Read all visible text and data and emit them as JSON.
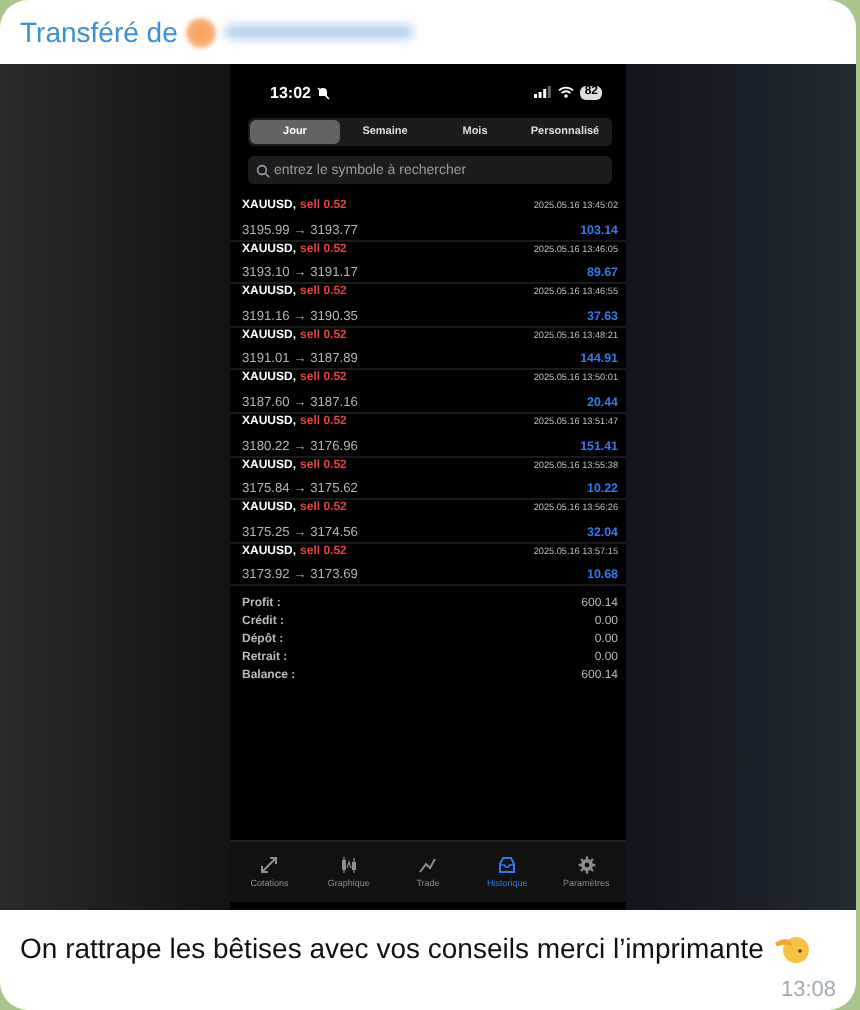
{
  "message": {
    "forwarded_label": "Transféré de",
    "text": "On rattrape les bêtises avec vos conseils merci l’imprimante",
    "time": "13:08"
  },
  "phone": {
    "status_time": "13:02",
    "battery": "82",
    "periods": [
      {
        "label": "Jour",
        "selected": true
      },
      {
        "label": "Semaine",
        "selected": false
      },
      {
        "label": "Mois",
        "selected": false
      },
      {
        "label": "Personnalisé",
        "selected": false
      }
    ],
    "search": {
      "placeholder": "entrez le symbole à rechercher"
    },
    "deals": [
      {
        "symbol": "XAUUSD,",
        "side": "sell 0.52",
        "prices": "3195.99 → 3193.77",
        "time": "2025.05.16 13:45:02",
        "profit": "103.14"
      },
      {
        "symbol": "XAUUSD,",
        "side": "sell 0.52",
        "prices": "3193.10 → 3191.17",
        "time": "2025.05.16 13:46:05",
        "profit": "89.67"
      },
      {
        "symbol": "XAUUSD,",
        "side": "sell 0.52",
        "prices": "3191.16 → 3190.35",
        "time": "2025.05.16 13:46:55",
        "profit": "37.63"
      },
      {
        "symbol": "XAUUSD,",
        "side": "sell 0.52",
        "prices": "3191.01 → 3187.89",
        "time": "2025.05.16 13:48:21",
        "profit": "144.91"
      },
      {
        "symbol": "XAUUSD,",
        "side": "sell 0.52",
        "prices": "3187.60 → 3187.16",
        "time": "2025.05.16 13:50:01",
        "profit": "20.44"
      },
      {
        "symbol": "XAUUSD,",
        "side": "sell 0.52",
        "prices": "3180.22 → 3176.96",
        "time": "2025.05.16 13:51:47",
        "profit": "151.41"
      },
      {
        "symbol": "XAUUSD,",
        "side": "sell 0.52",
        "prices": "3175.84 → 3175.62",
        "time": "2025.05.16 13:55:38",
        "profit": "10.22"
      },
      {
        "symbol": "XAUUSD,",
        "side": "sell 0.52",
        "prices": "3175.25 → 3174.56",
        "time": "2025.05.16 13:56:26",
        "profit": "32.04"
      },
      {
        "symbol": "XAUUSD,",
        "side": "sell 0.52",
        "prices": "3173.92 → 3173.69",
        "time": "2025.05.16 13:57:15",
        "profit": "10.68"
      }
    ],
    "summary": [
      {
        "label": "Profit :",
        "value": "600.14"
      },
      {
        "label": "Crédit :",
        "value": "0.00"
      },
      {
        "label": "Dépôt :",
        "value": "0.00"
      },
      {
        "label": "Retrait :",
        "value": "0.00"
      },
      {
        "label": "Balance :",
        "value": "600.14"
      }
    ],
    "nav": [
      {
        "kind": "quotes",
        "label": "Cotations",
        "selected": false
      },
      {
        "kind": "chart",
        "label": "Graphique",
        "selected": false
      },
      {
        "kind": "trade",
        "label": "Trade",
        "selected": false
      },
      {
        "kind": "history",
        "label": "Historique",
        "selected": true
      },
      {
        "kind": "settings",
        "label": "Paramètres",
        "selected": false
      }
    ]
  }
}
